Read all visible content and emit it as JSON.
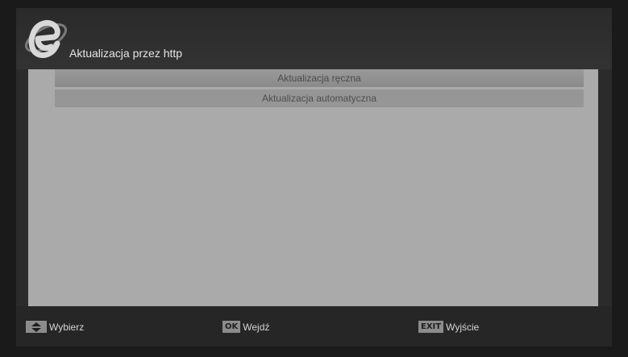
{
  "header": {
    "title": "Aktualizacja przez http",
    "logo_icon": "e-logo-icon"
  },
  "menu": {
    "items": [
      {
        "label": "Aktualizacja ręczna",
        "selected": true
      },
      {
        "label": "Aktualizacja automatyczna",
        "selected": false
      }
    ]
  },
  "footer": {
    "select": {
      "key": "",
      "label": "Wybierz",
      "icon": "up-down-arrows-icon"
    },
    "enter": {
      "key": "OK",
      "label": "Wejdź"
    },
    "exit": {
      "key": "EXIT",
      "label": "Wyjście"
    }
  },
  "colors": {
    "panel": "#aaaaaa",
    "selected_row": "#8f8f8f",
    "row": "#969696",
    "background": "#1a1a1a"
  }
}
